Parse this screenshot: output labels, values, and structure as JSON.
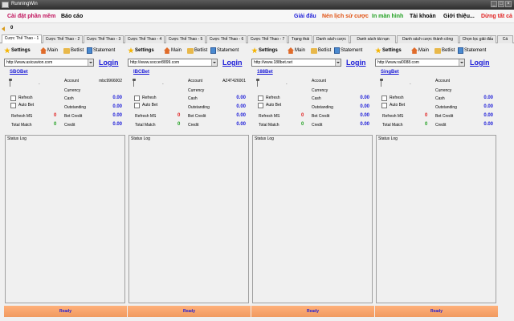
{
  "window": {
    "title": "RunningWin"
  },
  "menu": {
    "left": [
      "Cài đặt phần mềm",
      "Báo cáo"
    ],
    "right": [
      "Giải đấu",
      "Nén lịch sử cược",
      "In màn hình",
      "Tài khoản",
      "Giới thiệu...",
      "Dừng tất cả"
    ]
  },
  "counter": "0",
  "tabs": [
    "Cược Thể Thao - 1",
    "Cược Thể Thao - 2",
    "Cược Thể Thao - 3",
    "Cược Thể Thao - 4",
    "Cược Thể Thao - 5",
    "Cược Thể Thao - 6",
    "Cược Thể Thao - 7",
    "Trạng thái",
    "Danh sách cược",
    "Danh sách tài nạn",
    "Danh sách cược thành công",
    "Chọn lọc giải đấu",
    "Cá"
  ],
  "toolbar": {
    "settings": "Settings",
    "main": "Main",
    "betlist": "Betlist",
    "statement": "Statement"
  },
  "labels": {
    "login": "Login",
    "account": "Account",
    "currency": "Currency",
    "cash": "Cash",
    "outstanding": "Outstanding",
    "refresh": "Refresh",
    "auto_bet": "Auto Bet",
    "refresh_ms": "Refresh MS",
    "total_match": "Total Match",
    "bet_credit": "Bet Credit",
    "credit": "Credit",
    "status_log": "Status Log",
    "dash": "-"
  },
  "panels": [
    {
      "url": "http://www.asicuwion.com",
      "bookie": "SBOBet",
      "account": "mbc9966002",
      "cash": "0.00",
      "outstanding": "0.00",
      "refresh_ms": "0",
      "total_match": "0",
      "bet_credit": "0.00",
      "credit": "0.00",
      "status": "Ready"
    },
    {
      "url": "http://www.soccer8899.com",
      "bookie": "IBCBet",
      "account": "AZ4T426001",
      "cash": "0.00",
      "outstanding": "0.00",
      "refresh_ms": "0",
      "total_match": "0",
      "bet_credit": "0.00",
      "credit": "0.00",
      "status": "Ready"
    },
    {
      "url": "http://www.188bet.net",
      "bookie": "188Bet",
      "account": "",
      "cash": "0.00",
      "outstanding": "0.00",
      "refresh_ms": "0",
      "total_match": "0",
      "bet_credit": "0.00",
      "credit": "0.00",
      "status": "Ready"
    },
    {
      "url": "http://www.rai0088.com",
      "bookie": "SingBet",
      "account": "",
      "cash": "0.00",
      "outstanding": "0.00",
      "refresh_ms": "0",
      "total_match": "0",
      "bet_credit": "0.00",
      "credit": "0.00",
      "status": "Ready"
    }
  ],
  "colors": {
    "link_blue": "#1a1ad8",
    "menu_red": "#c0105a",
    "status_orange": "#f09a60"
  }
}
